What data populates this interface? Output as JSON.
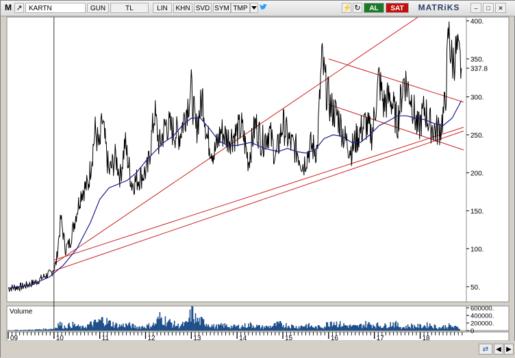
{
  "toolbar": {
    "m_label": "M",
    "symbol": "KARTN",
    "buttons": [
      "GUN",
      "TL",
      "LIN",
      "KHN",
      "SVD",
      "SYM",
      "TMP"
    ],
    "dropdown_icon": "chevron-down-icon",
    "twitter_icon": "twitter-icon",
    "al_label": "AL",
    "sat_label": "SAT",
    "brand": "MATRiKS",
    "window_icons": [
      "minimize-icon",
      "maximize-icon",
      "close-icon"
    ]
  },
  "colors": {
    "price": "#000000",
    "moving_average": "#1a1a8c",
    "channel": "#cc1f1f",
    "volume": "#1f4f8a",
    "crosshair": "#000000"
  },
  "chart_data": [
    {
      "type": "line",
      "title": "",
      "y_axis_side": "right",
      "ylim": [
        30,
        405
      ],
      "y_ticks": [
        "400.",
        "350.",
        "300.",
        "250.",
        "200.",
        "150.",
        "100.",
        "50."
      ],
      "y_tick_values": [
        400,
        350,
        300,
        250,
        200,
        150,
        100,
        50
      ],
      "last_price_label": "337.8",
      "last_price": 337.8,
      "x_ticks": [
        "09",
        "10",
        "11",
        "12",
        "13",
        "14",
        "15",
        "16",
        "17",
        "18"
      ],
      "xlim": [
        2009.0,
        2018.95
      ],
      "grid": false,
      "series": [
        {
          "role": "price",
          "x": [
            2009.0,
            2009.3,
            2009.6,
            2009.8,
            2009.95,
            2010.05,
            2010.15,
            2010.25,
            2010.35,
            2010.5,
            2010.6,
            2010.75,
            2010.9,
            2011.0,
            2011.05,
            2011.2,
            2011.35,
            2011.45,
            2011.55,
            2011.7,
            2011.9,
            2012.05,
            2012.2,
            2012.3,
            2012.45,
            2012.6,
            2012.75,
            2012.9,
            2013.0,
            2013.1,
            2013.25,
            2013.35,
            2013.5,
            2013.65,
            2013.8,
            2013.95,
            2014.1,
            2014.25,
            2014.4,
            2014.55,
            2014.7,
            2014.85,
            2015.0,
            2015.15,
            2015.3,
            2015.45,
            2015.6,
            2015.75,
            2015.85,
            2015.95,
            2016.05,
            2016.2,
            2016.35,
            2016.5,
            2016.65,
            2016.8,
            2016.95,
            2017.1,
            2017.2,
            2017.35,
            2017.5,
            2017.65,
            2017.8,
            2017.95,
            2018.1,
            2018.2,
            2018.35,
            2018.45,
            2018.55,
            2018.62,
            2018.7,
            2018.8,
            2018.9
          ],
          "y": [
            48,
            50,
            56,
            64,
            68,
            82,
            140,
            100,
            108,
            150,
            175,
            185,
            255,
            230,
            270,
            200,
            220,
            195,
            240,
            185,
            195,
            205,
            280,
            235,
            265,
            255,
            250,
            285,
            310,
            255,
            300,
            245,
            225,
            255,
            245,
            250,
            260,
            215,
            265,
            240,
            255,
            220,
            265,
            240,
            230,
            210,
            235,
            230,
            350,
            310,
            285,
            275,
            245,
            230,
            250,
            265,
            250,
            325,
            290,
            300,
            265,
            325,
            300,
            255,
            285,
            265,
            255,
            260,
            290,
            385,
            345,
            360,
            337.8
          ]
        },
        {
          "role": "moving_average",
          "x": [
            2009.0,
            2009.5,
            2009.9,
            2010.2,
            2010.5,
            2010.8,
            2011.0,
            2011.2,
            2011.4,
            2011.6,
            2011.8,
            2012.0,
            2012.2,
            2012.4,
            2012.6,
            2012.8,
            2013.0,
            2013.2,
            2013.4,
            2013.6,
            2013.8,
            2014.0,
            2014.3,
            2014.6,
            2014.9,
            2015.1,
            2015.3,
            2015.5,
            2015.7,
            2015.9,
            2016.1,
            2016.3,
            2016.5,
            2016.7,
            2016.9,
            2017.1,
            2017.3,
            2017.5,
            2017.7,
            2017.9,
            2018.1,
            2018.3,
            2018.5,
            2018.7,
            2018.9
          ],
          "y": [
            48,
            52,
            63,
            78,
            100,
            135,
            165,
            180,
            185,
            190,
            200,
            215,
            228,
            240,
            248,
            262,
            272,
            272,
            258,
            242,
            236,
            236,
            240,
            232,
            228,
            232,
            228,
            226,
            230,
            245,
            250,
            248,
            240,
            240,
            250,
            262,
            268,
            275,
            275,
            272,
            270,
            265,
            262,
            272,
            295
          ]
        }
      ],
      "channel_lines": [
        {
          "x": [
            2010.0,
            2018.0
          ],
          "y": [
            80,
            407
          ]
        },
        {
          "x": [
            2010.0,
            2018.95
          ],
          "y": [
            85,
            260
          ]
        },
        {
          "x": [
            2009.95,
            2018.95
          ],
          "y": [
            70,
            255
          ]
        },
        {
          "x": [
            2016.0,
            2018.95
          ],
          "y": [
            350,
            293
          ]
        },
        {
          "x": [
            2016.0,
            2018.95
          ],
          "y": [
            290,
            230
          ]
        }
      ]
    },
    {
      "type": "bar",
      "title": "Volume",
      "y_axis_side": "right",
      "ylim": [
        0,
        650000
      ],
      "y_ticks": [
        "600000.",
        "400000.",
        "200000.",
        "0"
      ],
      "y_tick_values": [
        600000,
        400000,
        200000,
        0
      ],
      "x": [
        2009.0,
        2009.5,
        2010.0,
        2010.1,
        2010.2,
        2010.4,
        2010.6,
        2010.8,
        2010.95,
        2011.05,
        2011.2,
        2011.4,
        2011.6,
        2011.8,
        2012.0,
        2012.2,
        2012.3,
        2012.5,
        2012.7,
        2012.9,
        2013.0,
        2013.1,
        2013.3,
        2013.5,
        2013.7,
        2013.9,
        2014.1,
        2014.3,
        2014.5,
        2014.7,
        2014.9,
        2015.1,
        2015.3,
        2015.5,
        2015.7,
        2015.9,
        2016.05,
        2016.2,
        2016.4,
        2016.6,
        2016.8,
        2017.0,
        2017.2,
        2017.4,
        2017.6,
        2017.8,
        2018.0,
        2018.2,
        2018.4,
        2018.6,
        2018.7,
        2018.85
      ],
      "values": [
        15000,
        25000,
        60000,
        230000,
        120000,
        180000,
        90000,
        200000,
        260000,
        330000,
        240000,
        150000,
        180000,
        110000,
        130000,
        200000,
        400000,
        260000,
        150000,
        210000,
        580000,
        320000,
        250000,
        120000,
        160000,
        120000,
        140000,
        180000,
        110000,
        120000,
        200000,
        160000,
        110000,
        170000,
        100000,
        140000,
        300000,
        200000,
        150000,
        120000,
        200000,
        180000,
        140000,
        230000,
        100000,
        150000,
        130000,
        180000,
        90000,
        150000,
        120000,
        80000
      ]
    }
  ]
}
